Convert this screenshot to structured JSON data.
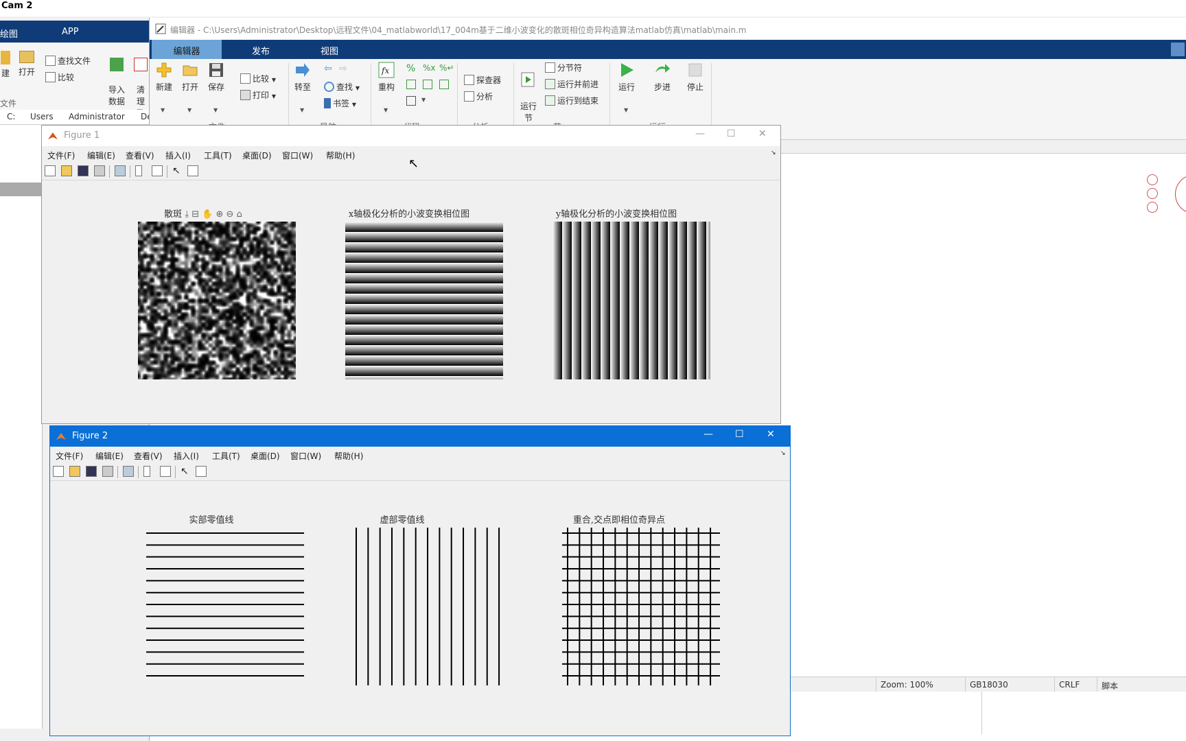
{
  "main_app": {
    "title": "Cam 2",
    "tabs": [
      "绘图",
      "APP"
    ],
    "ribbon": {
      "buttons": [
        "建",
        "打开",
        "查找文件",
        "比较",
        "导入\n数据",
        "清理\n数据"
      ],
      "group_file": "文件"
    },
    "breadcrumb": [
      "C:",
      "Users",
      "Administrator",
      "De"
    ]
  },
  "editor": {
    "title": "编辑器 - C:\\Users\\Administrator\\Desktop\\远程文件\\04_matlabworld\\17_004m基于二维小波变化的散斑相位奇异构造算法matlab仿真\\matlab\\main.m",
    "tabs": [
      "编辑器",
      "发布",
      "视图"
    ],
    "groups": {
      "file": {
        "label": "文件",
        "new": "新建",
        "open": "打开",
        "save": "保存",
        "compare": "比较",
        "print": "打印"
      },
      "nav": {
        "label": "导航",
        "goto": "转至",
        "find": "查找",
        "bookmark": "书签"
      },
      "code": {
        "label": "代码",
        "refactor": "重构"
      },
      "analyze": {
        "label": "分析",
        "profiler": "探查器",
        "analyze": "分析"
      },
      "section": {
        "label": "节",
        "run_section": "运行\n节",
        "section_break": "分节符",
        "run_advance": "运行并前进",
        "run_to_end": "运行到结束"
      },
      "run": {
        "label": "运行",
        "run": "运行",
        "step": "步进",
        "stop": "停止"
      }
    },
    "status": {
      "zoom": "Zoom: 100%",
      "encoding": "GB18030",
      "eol": "CRLF",
      "type": "脚本"
    }
  },
  "figure1": {
    "title": "Figure 1",
    "menu": [
      "文件(F)",
      "编辑(E)",
      "查看(V)",
      "插入(I)",
      "工具(T)",
      "桌面(D)",
      "窗口(W)",
      "帮助(H)"
    ],
    "axes": [
      {
        "title": "散斑"
      },
      {
        "title": "x轴极化分析的小波变换相位图"
      },
      {
        "title": "y轴极化分析的小波变换相位图"
      }
    ]
  },
  "figure2": {
    "title": "Figure 2",
    "menu": [
      "文件(F)",
      "编辑(E)",
      "查看(V)",
      "插入(I)",
      "工具(T)",
      "桌面(D)",
      "窗口(W)",
      "帮助(H)"
    ],
    "axes": [
      {
        "title": "实部零值线"
      },
      {
        "title": "虚部零值线"
      },
      {
        "title": "重合,交点即相位奇异点"
      }
    ]
  },
  "colors": {
    "ribbon_blue": "#0f3c78",
    "active_tab": "#6ca4d8",
    "fig2_title": "#0a6fd6"
  }
}
